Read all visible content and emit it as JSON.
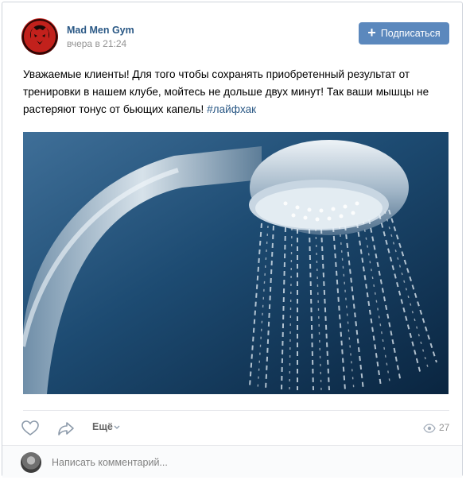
{
  "post": {
    "author": "Mad Men Gym",
    "time": "вчера в 21:24",
    "subscribe_label": "Подписаться",
    "text": "Уважаемые клиенты! Для того чтобы сохранять приобретенный результат от тренировки в нашем клубе, мойтесь не дольше двух минут! Так ваши мышцы не растеряют тонус от бьющих капель!",
    "hashtag": "#лайфхак",
    "image_icon": "shower-head-photo"
  },
  "actions": {
    "like_icon": "heart-icon",
    "share_icon": "share-arrow-icon",
    "more_label": "Ещё",
    "views_icon": "eye-icon",
    "views_count": "27"
  },
  "comment": {
    "placeholder": "Написать комментарий..."
  },
  "colors": {
    "link": "#2a5885",
    "button": "#5b88bd",
    "meta": "#939393"
  }
}
